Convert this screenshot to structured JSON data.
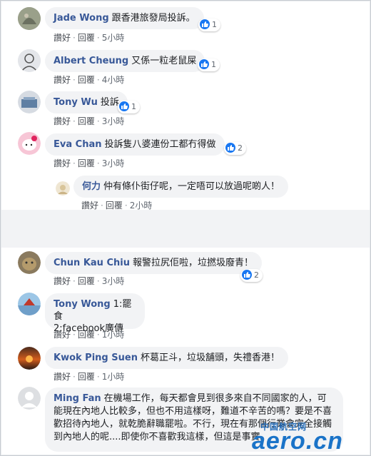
{
  "actions": {
    "like": "讚好",
    "reply": "回覆",
    "sep": "·"
  },
  "comments": [
    {
      "name": "Jade Wong",
      "text": "跟香港旅發局投訴。",
      "time": "5小時",
      "reactions": "1"
    },
    {
      "name": "Albert Cheung",
      "text": "又係一粒老鼠屎",
      "time": "4小時",
      "reactions": "1"
    },
    {
      "name": "Tony Wu",
      "text": "投訴",
      "time": "3小時",
      "reactions": "1"
    },
    {
      "name": "Eva Chan",
      "text": "投訴隻八婆連份工都冇得做",
      "time": "3小時",
      "reactions": "2"
    },
    {
      "name": "何力",
      "text": "仲有條仆街仔呢，一定唔可以放過呢啲人！",
      "time": "2小時"
    },
    {
      "name": "Chun Kau Chiu",
      "text": "報警拉尻佢啦，垃撚圾廢青！",
      "time": "3小時",
      "reactions": "2"
    },
    {
      "name": "Tony Wong",
      "text_line1": "1:罷食",
      "text_line2": "2:facebook廣傳",
      "time": "1小時"
    },
    {
      "name": "Kwok Ping Suen",
      "text": "杯葛正斗，垃圾舖頭，失禮香港！",
      "time": "1小時"
    },
    {
      "name": "Ming Fan",
      "text": "在機場工作，每天都會見到很多來自不同國家的人，可能現在內地人比較多，但也不用這樣呀，難道不辛苦的嗎？要是不喜歡招待內地人，就乾脆辭職罷啦。不行，現在有那個行業會完全接觸到內地人的呢....即使你不喜歡我這樣，但這是事實。"
    }
  ],
  "watermark": {
    "cn": "中国航空网",
    "en": "aero.cn"
  }
}
